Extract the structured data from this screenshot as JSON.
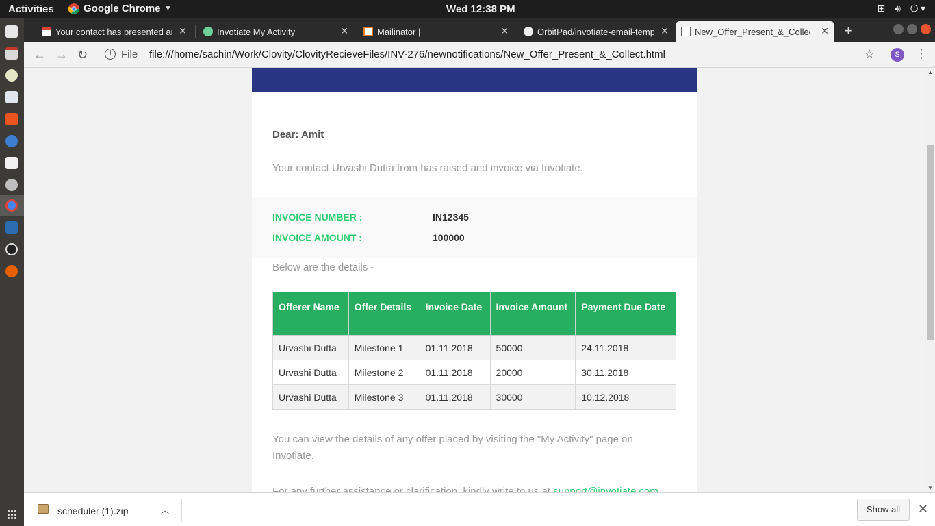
{
  "system": {
    "activities": "Activities",
    "app_name": "Google Chrome",
    "clock": "Wed 12:38 PM"
  },
  "tabs": [
    {
      "label": "Your contact has presented an",
      "icon": "gmail-icon"
    },
    {
      "label": "Invotiate My Activity",
      "icon": "invotiate-icon"
    },
    {
      "label": "Mailinator |",
      "icon": "mailinator-icon"
    },
    {
      "label": "OrbitPad/invotiate-email-temp",
      "icon": "github-icon"
    },
    {
      "label": "New_Offer_Present_&_Collect",
      "icon": "page-icon",
      "active": true
    }
  ],
  "toolbar": {
    "file_label": "File",
    "url": "file:///home/sachin/Work/Clovity/ClovityRecieveFiles/INV-276/newnotifications/New_Offer_Present_&_Collect.html",
    "profile_initial": "S"
  },
  "email": {
    "greeting": "Dear: Amit",
    "intro": "Your contact Urvashi Dutta from has raised and invoice via Invotiate.",
    "invoice_number_label": "INVOICE NUMBER :",
    "invoice_number": "IN12345",
    "invoice_amount_label": "INVOICE AMOUNT :",
    "invoice_amount": "100000",
    "details_intro": "Below are the details -",
    "table": {
      "headers": [
        "Offerer Name",
        "Offer Details",
        "Invoice Date",
        "Invoice Amount",
        "Payment Due Date"
      ],
      "rows": [
        [
          "Urvashi Dutta",
          "Milestone 1",
          "01.11.2018",
          "50000",
          "24.11.2018"
        ],
        [
          "Urvashi Dutta",
          "Milestone 2",
          "01.11.2018",
          "20000",
          "30.11.2018"
        ],
        [
          "Urvashi Dutta",
          "Milestone 3",
          "01.11.2018",
          "30000",
          "10.12.2018"
        ]
      ]
    },
    "footer": "You can view the details of any offer placed by visiting the \"My Activity\" page on Invotiate.",
    "support_prefix": "For any further assistance or clarification, kindly write to us at ",
    "support_email": "support@invotiate.com"
  },
  "downloads": {
    "file_name": "scheduler (1).zip",
    "show_all": "Show all"
  },
  "colors": {
    "header_band": "#283583",
    "accent_green": "#27ae60",
    "label_green": "#2ecc71"
  }
}
